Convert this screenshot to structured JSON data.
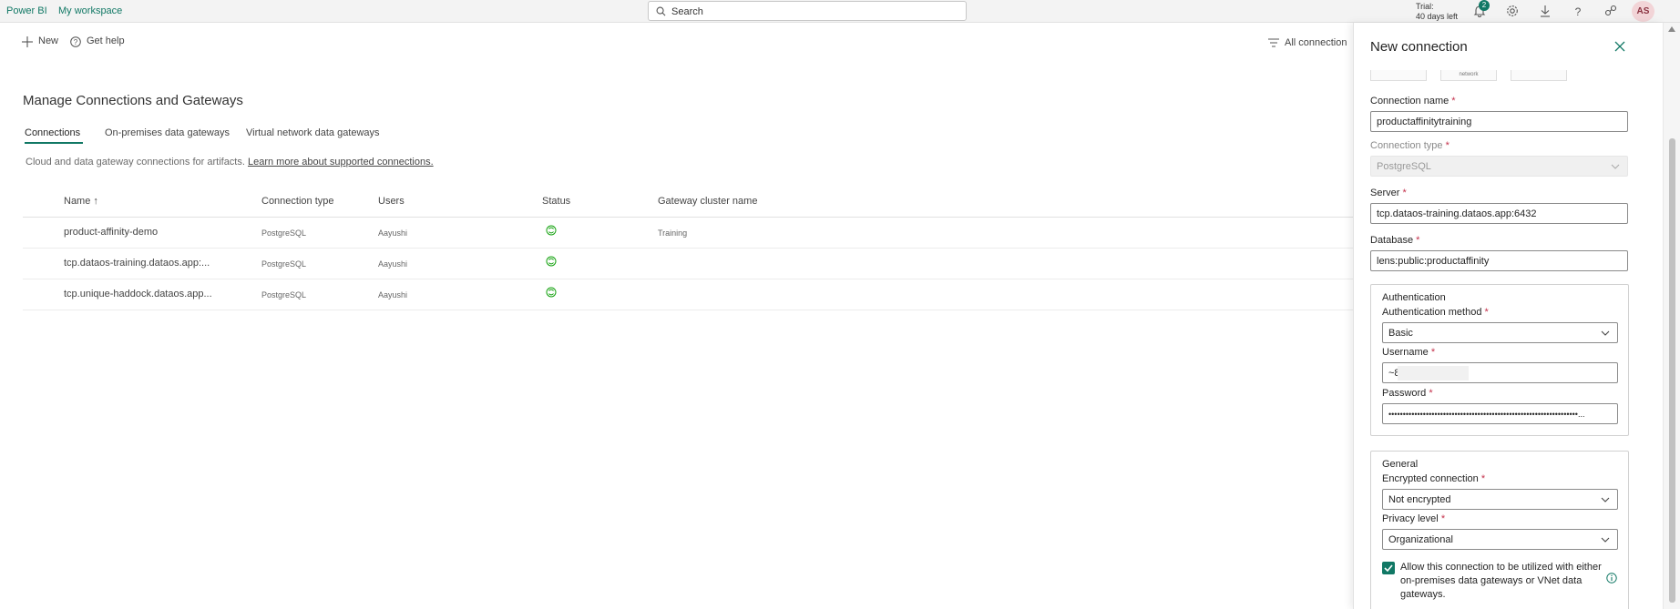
{
  "header": {
    "brand": "Power BI",
    "workspace": "My workspace",
    "search_placeholder": "Search",
    "trial_line1": "Trial:",
    "trial_line2": "40 days left",
    "notification_count": "2",
    "avatar_initials": "AS"
  },
  "commands": {
    "new_label": "New",
    "help_label": "Get help",
    "all_connections_label": "All connection"
  },
  "page": {
    "title": "Manage Connections and Gateways",
    "tabs": [
      {
        "label": "Connections",
        "active": true
      },
      {
        "label": "On-premises data gateways",
        "active": false
      },
      {
        "label": "Virtual network data gateways",
        "active": false
      }
    ],
    "description": "Cloud and data gateway connections for artifacts.",
    "learn_more": "Learn more about supported connections."
  },
  "table": {
    "columns": [
      "Name ↑",
      "Connection type",
      "Users",
      "Status",
      "Gateway cluster name"
    ],
    "rows": [
      {
        "name": "product-affinity-demo",
        "type": "PostgreSQL",
        "users": "Aayushi",
        "gateway": "Training"
      },
      {
        "name": "tcp.dataos-training.dataos.app:...",
        "type": "PostgreSQL",
        "users": "Aayushi",
        "gateway": ""
      },
      {
        "name": "tcp.unique-haddock.dataos.app...",
        "type": "PostgreSQL",
        "users": "Aayushi",
        "gateway": ""
      }
    ]
  },
  "panel": {
    "title": "New connection",
    "tile_label": "network",
    "connection_name_label": "Connection name",
    "connection_name_value": "productaffinitytraining",
    "connection_type_label": "Connection type",
    "connection_type_value": "PostgreSQL",
    "server_label": "Server",
    "server_value": "tcp.dataos-training.dataos.app:6432",
    "database_label": "Database",
    "database_value": "lens:public:productaffinity",
    "auth_title": "Authentication",
    "auth_method_label": "Authentication method",
    "auth_method_value": "Basic",
    "username_label": "Username",
    "username_value": "~8",
    "password_label": "Password",
    "password_value": "••••••••••••••••••••••••••••••••••••••••••••••••••••••••••••••••••...",
    "general_title": "General",
    "encrypted_label": "Encrypted connection",
    "encrypted_value": "Not encrypted",
    "privacy_label": "Privacy level",
    "privacy_value": "Organizational",
    "allow_text": "Allow this connection to be utilized with either on-premises data gateways or VNet data gateways."
  },
  "colors": {
    "accent": "#117865",
    "required": "#c4314b"
  }
}
